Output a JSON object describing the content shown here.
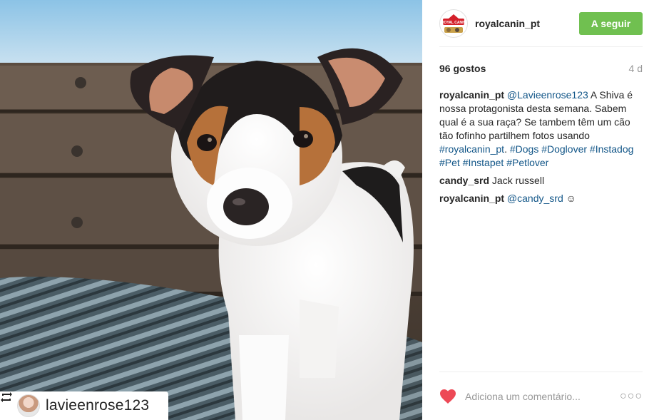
{
  "post": {
    "account": {
      "username": "royalcanin_pt",
      "avatar_brand": "ROYAL CANIN"
    },
    "follow_label": "A seguir",
    "likes": "96 gostos",
    "age": "4 d",
    "photo": {
      "repost_username": "lavieenrose123",
      "icon": "repost-icon",
      "subject": "puppy-on-bench"
    },
    "comments": [
      {
        "user": "royalcanin_pt",
        "parts": [
          {
            "text": "@Lavieenrose123",
            "link": true
          },
          {
            "text": " A Shiva é nossa protagonista desta semana. Sabem qual é a sua raça? Se tambem têm um cão tão fofinho partilhem fotos usando ",
            "link": false
          },
          {
            "text": "#royalcanin_pt",
            "link": true
          },
          {
            "text": ". ",
            "link": false
          },
          {
            "text": "#Dogs",
            "link": true
          },
          {
            "text": " ",
            "link": false
          },
          {
            "text": "#Doglover",
            "link": true
          },
          {
            "text": " ",
            "link": false
          },
          {
            "text": "#Instadog",
            "link": true
          },
          {
            "text": " ",
            "link": false
          },
          {
            "text": "#Pet",
            "link": true
          },
          {
            "text": " ",
            "link": false
          },
          {
            "text": "#Instapet",
            "link": true
          },
          {
            "text": " ",
            "link": false
          },
          {
            "text": "#Petlover",
            "link": true
          }
        ]
      },
      {
        "user": "candy_srd",
        "parts": [
          {
            "text": " Jack russell",
            "link": false
          }
        ]
      },
      {
        "user": "royalcanin_pt",
        "parts": [
          {
            "text": " ",
            "link": false
          },
          {
            "text": "@candy_srd",
            "link": true
          },
          {
            "text": " ☺",
            "link": false
          }
        ]
      }
    ],
    "comment_placeholder": "Adiciona um comentário...",
    "icons": {
      "like": "heart-icon",
      "more": "more-options-icon"
    },
    "more_label": "○○○"
  },
  "colors": {
    "follow_button": "#70c050",
    "link": "#125688",
    "heart": "#ed4956"
  }
}
